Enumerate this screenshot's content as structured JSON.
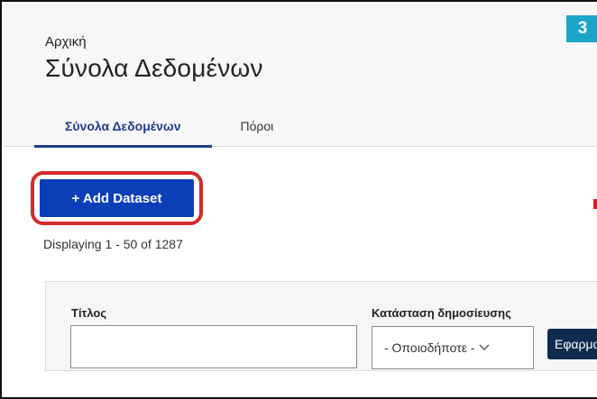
{
  "header": {
    "breadcrumb": "Αρχική",
    "title": "Σύνολα Δεδομένων",
    "step_badge": "3"
  },
  "tabs": [
    {
      "label": "Σύνολα Δεδομένων",
      "active": true
    },
    {
      "label": "Πόροι",
      "active": false
    }
  ],
  "actions": {
    "add_dataset_label": "+ Add Dataset"
  },
  "results": {
    "display_count": "Displaying 1 - 50 of 1287"
  },
  "filters": {
    "title_label": "Τίτλος",
    "title_value": "",
    "status_label": "Κατάσταση δημοσίευσης",
    "status_selected": "- Οποιοδήποτε -",
    "apply_label": "Εφαρμογή"
  },
  "colors": {
    "primary_button": "#0a3fb8",
    "highlight_ring": "#d42b2b",
    "step_badge": "#1aa6c8",
    "apply_button": "#0f2c4f",
    "active_tab": "#1f3c8a"
  },
  "icons": {
    "status_dropdown": "chevron-down-icon"
  }
}
